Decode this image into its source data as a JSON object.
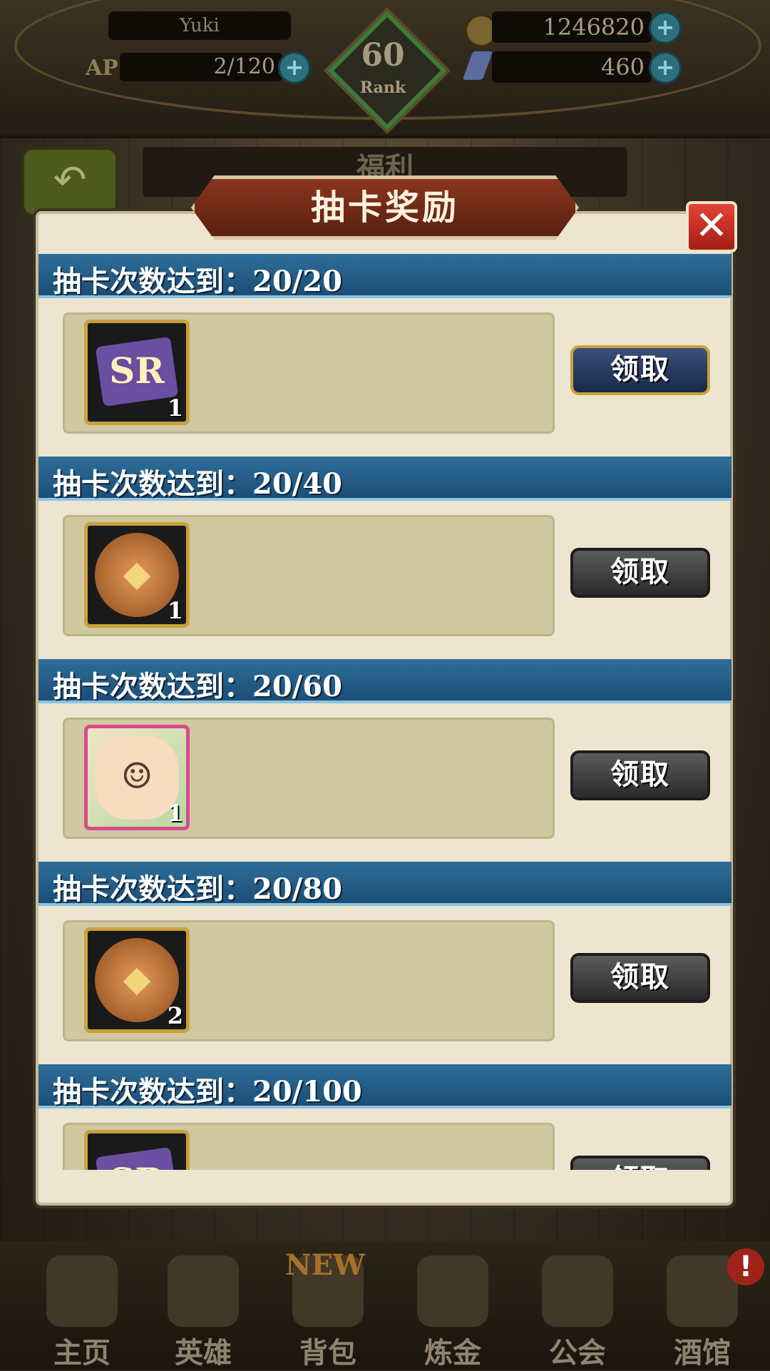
{
  "topbar": {
    "player_name": "Yuki",
    "ap_label": "AP",
    "ap_value": "2/120",
    "rank_number": "60",
    "rank_label": "Rank",
    "coins": "1246820",
    "gems": "460",
    "plus_symbol": "+"
  },
  "back_button": {
    "icon": "back-arrow-icon",
    "symbol": "↶"
  },
  "sub_banner": {
    "title": "福利"
  },
  "modal": {
    "title": "抽卡奖励",
    "close_symbol": "✕",
    "items": [
      {
        "header": "抽卡次数达到：20/20",
        "reward_icon": "sr-ticket-icon",
        "reward_glyph": "SR",
        "quantity": "1",
        "claim_label": "领取",
        "claimable": true
      },
      {
        "header": "抽卡次数达到：20/40",
        "reward_icon": "crest-icon",
        "reward_glyph": "◆",
        "quantity": "1",
        "claim_label": "领取",
        "claimable": false
      },
      {
        "header": "抽卡次数达到：20/60",
        "reward_icon": "hero-portrait-icon",
        "reward_glyph": "☺",
        "quantity": "1",
        "claim_label": "领取",
        "claimable": false
      },
      {
        "header": "抽卡次数达到：20/80",
        "reward_icon": "crest-icon",
        "reward_glyph": "◆",
        "quantity": "2",
        "claim_label": "领取",
        "claimable": false
      },
      {
        "header": "抽卡次数达到：20/100",
        "reward_icon": "sr-ticket-icon",
        "reward_glyph": "SR",
        "quantity": "",
        "claim_label": "领取",
        "claimable": false
      }
    ]
  },
  "bottom_nav": {
    "items": [
      {
        "label": "主页",
        "icon": "castle-icon"
      },
      {
        "label": "英雄",
        "icon": "hero-helmet-icon"
      },
      {
        "label": "背包",
        "icon": "backpack-icon"
      },
      {
        "label": "炼金",
        "icon": "alchemy-flask-icon"
      },
      {
        "label": "公会",
        "icon": "guild-shield-icon"
      },
      {
        "label": "酒馆",
        "icon": "tavern-mug-icon"
      }
    ],
    "new_badge": "NEW",
    "alert_badge": "!"
  },
  "colors": {
    "header_blue": "#1b4e76",
    "claim_active": "#1a2a4a",
    "claim_inactive": "#2a2a2a",
    "close_red": "#c0281c",
    "title_plaque": "#7a2e1a"
  }
}
